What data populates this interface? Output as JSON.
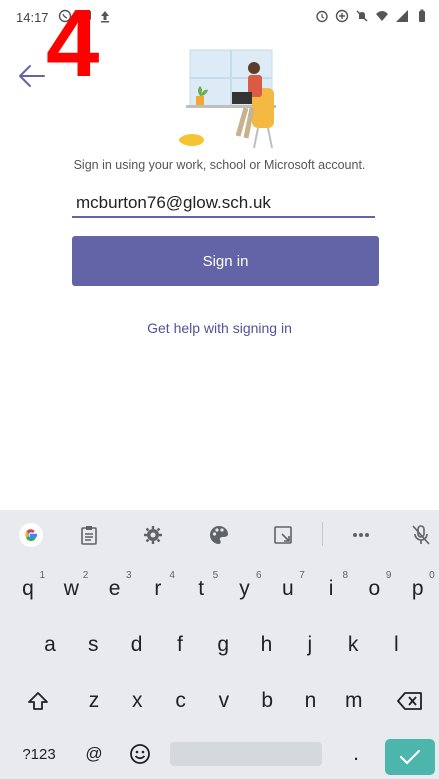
{
  "status_bar": {
    "time": "14:17",
    "left_icons": [
      "whatsapp-icon",
      "message-icon",
      "upload-icon"
    ],
    "right_icons": [
      "alarm-icon",
      "data-saver-icon",
      "mute-icon",
      "wifi-icon",
      "signal-icon",
      "battery-icon"
    ]
  },
  "overlay": {
    "step_number": "4"
  },
  "signin": {
    "prompt": "Sign in using your work, school or Microsoft account.",
    "email_value": "mcburton76@glow.sch.uk",
    "button_label": "Sign in",
    "help_link": "Get help with signing in"
  },
  "colors": {
    "accent": "#6264a7",
    "overlay_red": "#ff0000",
    "enter_key": "#4db6ac"
  },
  "keyboard": {
    "toolbar": [
      "google-icon",
      "clipboard-icon",
      "settings-icon",
      "theme-icon",
      "floating-keyboard-icon",
      "more-icon",
      "mic-off-icon"
    ],
    "row1": [
      {
        "key": "q",
        "hint": "1"
      },
      {
        "key": "w",
        "hint": "2"
      },
      {
        "key": "e",
        "hint": "3"
      },
      {
        "key": "r",
        "hint": "4"
      },
      {
        "key": "t",
        "hint": "5"
      },
      {
        "key": "y",
        "hint": "6"
      },
      {
        "key": "u",
        "hint": "7"
      },
      {
        "key": "i",
        "hint": "8"
      },
      {
        "key": "o",
        "hint": "9"
      },
      {
        "key": "p",
        "hint": "0"
      }
    ],
    "row2": [
      "a",
      "s",
      "d",
      "f",
      "g",
      "h",
      "j",
      "k",
      "l"
    ],
    "row3": [
      "z",
      "x",
      "c",
      "v",
      "b",
      "n",
      "m"
    ],
    "row4": {
      "symbols": "?123",
      "at": "@",
      "period": "."
    }
  }
}
